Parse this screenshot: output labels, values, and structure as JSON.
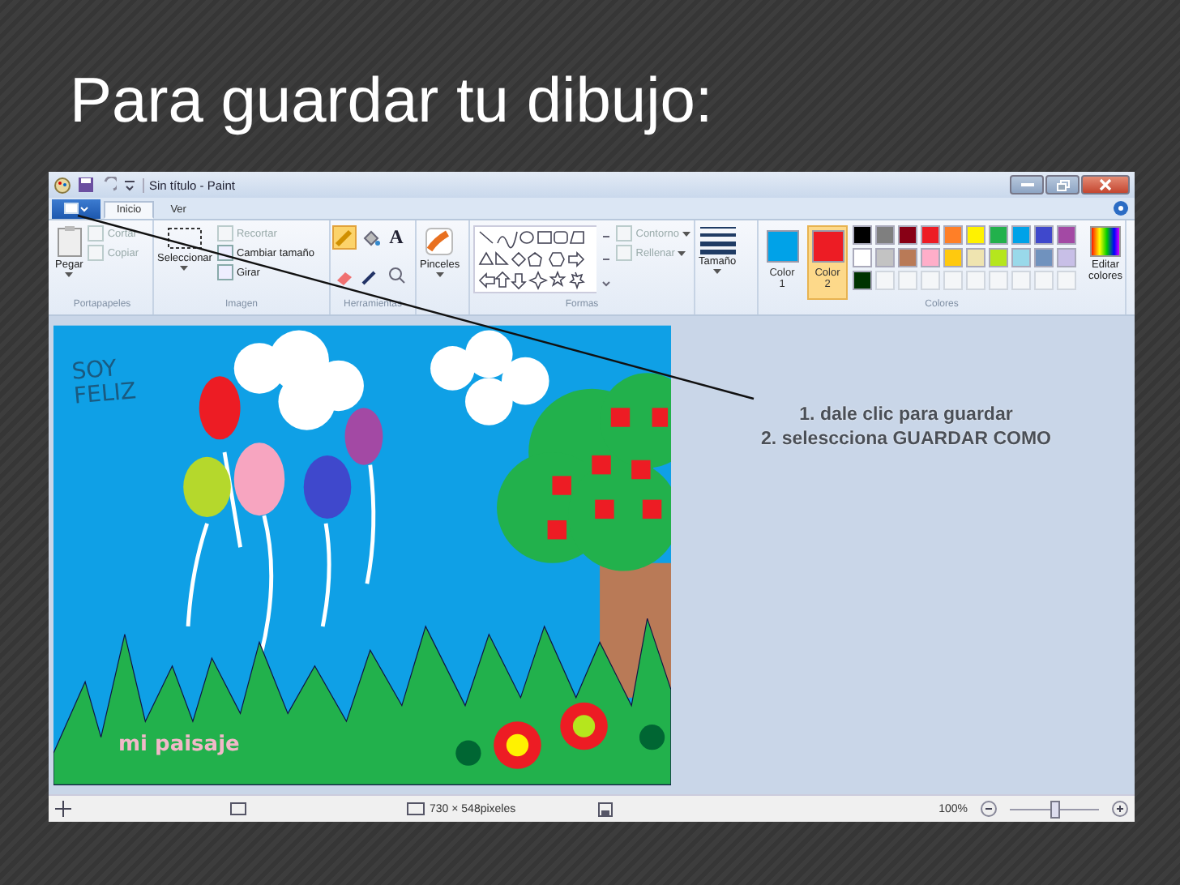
{
  "slide_title": "Para guardar tu dibujo:",
  "window": {
    "title": "Sin título - Paint"
  },
  "ribbon_tabs": [
    {
      "label": "Inicio",
      "selected": true
    },
    {
      "label": "Ver",
      "selected": false
    }
  ],
  "clipboard": {
    "label": "Portapapeles",
    "paste": "Pegar",
    "items": [
      {
        "label": "Cortar",
        "disabled": true
      },
      {
        "label": "Copiar",
        "disabled": true
      }
    ]
  },
  "image": {
    "label": "Imagen",
    "select": "Seleccionar",
    "items": [
      {
        "label": "Recortar",
        "disabled": true
      },
      {
        "label": "Cambiar tamaño",
        "disabled": false
      },
      {
        "label": "Girar",
        "disabled": false
      }
    ]
  },
  "tools": {
    "label": "Herramientas",
    "text_glyph": "A"
  },
  "brushes": {
    "label": "Pinceles"
  },
  "shapes": {
    "label": "Formas",
    "items": [
      {
        "label": "Contorno",
        "disabled": true
      },
      {
        "label": "Rellenar",
        "disabled": true
      }
    ]
  },
  "size": {
    "label": "Tamaño"
  },
  "colors": {
    "label": "Colores",
    "slots": [
      {
        "label": "Color 1",
        "color": "#00a2e8",
        "selected": false
      },
      {
        "label": "Color 2",
        "color": "#ed1c24",
        "selected": true
      }
    ],
    "palette": [
      {
        "color": "#000000"
      },
      {
        "color": "#7f7f7f"
      },
      {
        "color": "#880015"
      },
      {
        "color": "#ed1c24"
      },
      {
        "color": "#ff7f27"
      },
      {
        "color": "#fff200"
      },
      {
        "color": "#22b14c"
      },
      {
        "color": "#00a2e8"
      },
      {
        "color": "#3f48cc"
      },
      {
        "color": "#a349a4"
      },
      {
        "color": "#ffffff"
      },
      {
        "color": "#c3c3c3"
      },
      {
        "color": "#b97a57"
      },
      {
        "color": "#ffaec9"
      },
      {
        "color": "#ffc90e"
      },
      {
        "color": "#efe4b0"
      },
      {
        "color": "#b5e61d"
      },
      {
        "color": "#99d9ea"
      },
      {
        "color": "#7092be"
      },
      {
        "color": "#c8bfe7"
      },
      {
        "color": "#003300"
      }
    ],
    "edit": "Editar colores"
  },
  "canvas": {
    "scribble": "SOY FELIZ",
    "caption": "mi paisaje"
  },
  "annotation": [
    "1. dale clic para guardar",
    "2. selescciona GUARDAR COMO"
  ],
  "status_bar": {
    "canvas_size": "730 × 548pixeles",
    "zoom": "100%",
    "zoom_slider": {
      "level": 0.5
    }
  }
}
